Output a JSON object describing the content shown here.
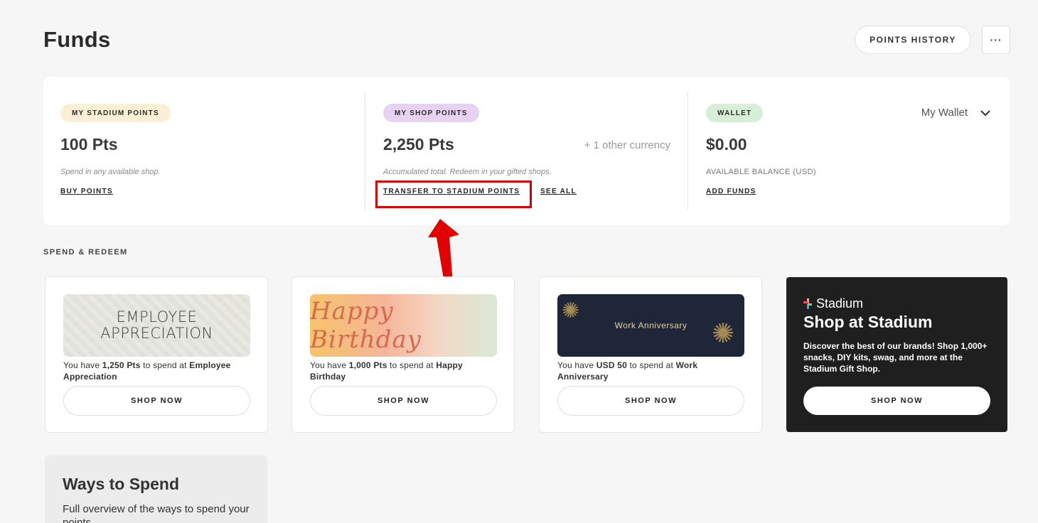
{
  "page": {
    "title": "Funds",
    "points_history_label": "POINTS HISTORY",
    "more_label": "···"
  },
  "funds": {
    "stadium": {
      "pill": "MY STADIUM POINTS",
      "pill_color": "#fbf0d6",
      "amount": "100 Pts",
      "note": "Spend in any available shop.",
      "link": "BUY POINTS"
    },
    "shop": {
      "pill": "MY SHOP POINTS",
      "pill_color": "#e8d2f4",
      "amount": "2,250 Pts",
      "other_currency": "+ 1 other currency",
      "note": "Accumulated total. Redeem in your gifted shops.",
      "link_transfer": "TRANSFER TO STADIUM POINTS",
      "link_see_all": "SEE ALL"
    },
    "wallet": {
      "pill": "WALLET",
      "pill_color": "#d6efd6",
      "amount": "$0.00",
      "selector": "My Wallet",
      "note": "AVAILABLE BALANCE (USD)",
      "link": "ADD FUNDS"
    }
  },
  "spend": {
    "section_label": "SPEND & REDEEM",
    "shops": [
      {
        "banner_text": "EMPLOYEE APPRECIATION",
        "prefix": "You have ",
        "amount": "1,250 Pts",
        "middle": " to spend at ",
        "shop_name": "Employee Appreciation",
        "button": "SHOP NOW"
      },
      {
        "banner_text": "Happy Birthday",
        "prefix": "You have ",
        "amount": "1,000 Pts",
        "middle": " to spend at ",
        "shop_name": "Happy Birthday",
        "button": "SHOP NOW"
      },
      {
        "banner_text": "Work Anniversary",
        "prefix": "You have ",
        "amount": "USD 50",
        "middle": " to spend at ",
        "shop_name": "Work Anniversary",
        "button": "SHOP NOW"
      }
    ],
    "stadium_shop": {
      "logo_text": "Stadium",
      "title": "Shop at Stadium",
      "description": "Discover the best of our brands! Shop 1,000+ snacks, DIY kits, swag, and more at the Stadium Gift Shop.",
      "button": "SHOP NOW"
    }
  },
  "ways": {
    "title": "Ways to Spend",
    "description": "Full overview of the ways to spend your points"
  },
  "colors": {
    "highlight": "#d00000",
    "dark_card": "#1f1f1f"
  }
}
